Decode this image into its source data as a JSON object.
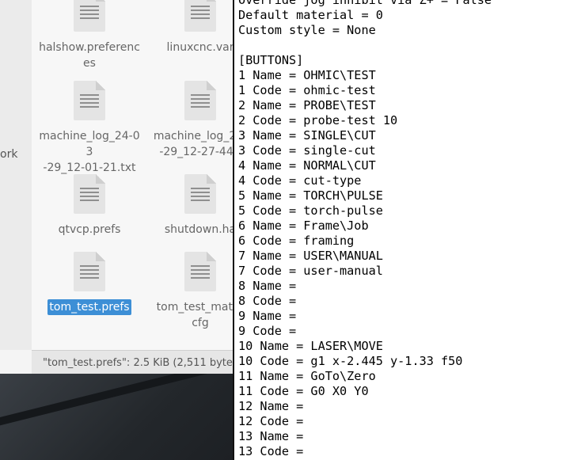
{
  "file_manager": {
    "sidebar_label": "ork",
    "items": [
      {
        "name": "halshow.preferences",
        "lines": [
          "halshow.preferenc",
          "es"
        ]
      },
      {
        "name": "linuxcnc.var",
        "lines": [
          "linuxcnc.var"
        ]
      },
      {
        "name": "machine_log_24-03-29_12-01-21.txt",
        "lines": [
          "machine_log_24-03",
          "-29_12-01-21.txt"
        ]
      },
      {
        "name": "machine_log_24-03-29_12-27-44.txt",
        "lines": [
          "machine_log_24-",
          "-29_12-27-44.t"
        ]
      },
      {
        "name": "qtvcp.prefs",
        "lines": [
          "qtvcp.prefs"
        ]
      },
      {
        "name": "shutdown.hal",
        "lines": [
          "shutdown.ha"
        ]
      },
      {
        "name": "tom_test.prefs",
        "lines": [
          "tom_test.prefs"
        ],
        "selected": true
      },
      {
        "name": "tom_test_material.cfg",
        "lines": [
          "tom_test_mater",
          "cfg"
        ]
      }
    ],
    "status_text": "\"tom_test.prefs\": 2.5 KiB (2,511 byte"
  },
  "terminal": {
    "lines": [
      "Override jog inhibit via Z+ = False",
      "Default material = 0",
      "Custom style = None",
      "",
      "[BUTTONS]",
      "1 Name = OHMIC\\TEST",
      "1 Code = ohmic-test",
      "2 Name = PROBE\\TEST",
      "2 Code = probe-test 10",
      "3 Name = SINGLE\\CUT",
      "3 Code = single-cut",
      "4 Name = NORMAL\\CUT",
      "4 Code = cut-type",
      "5 Name = TORCH\\PULSE",
      "5 Code = torch-pulse",
      "6 Name = Frame\\Job",
      "6 Code = framing",
      "7 Name = USER\\MANUAL",
      "7 Code = user-manual",
      "8 Name =",
      "8 Code =",
      "9 Name =",
      "9 Code =",
      "10 Name = LASER\\MOVE",
      "10 Code = g1 x-2.445 y-1.33 f50",
      "11 Name = GoTo\\Zero",
      "11 Code = G0 X0 Y0",
      "12 Name =",
      "12 Code =",
      "13 Name =",
      "13 Code ="
    ]
  }
}
